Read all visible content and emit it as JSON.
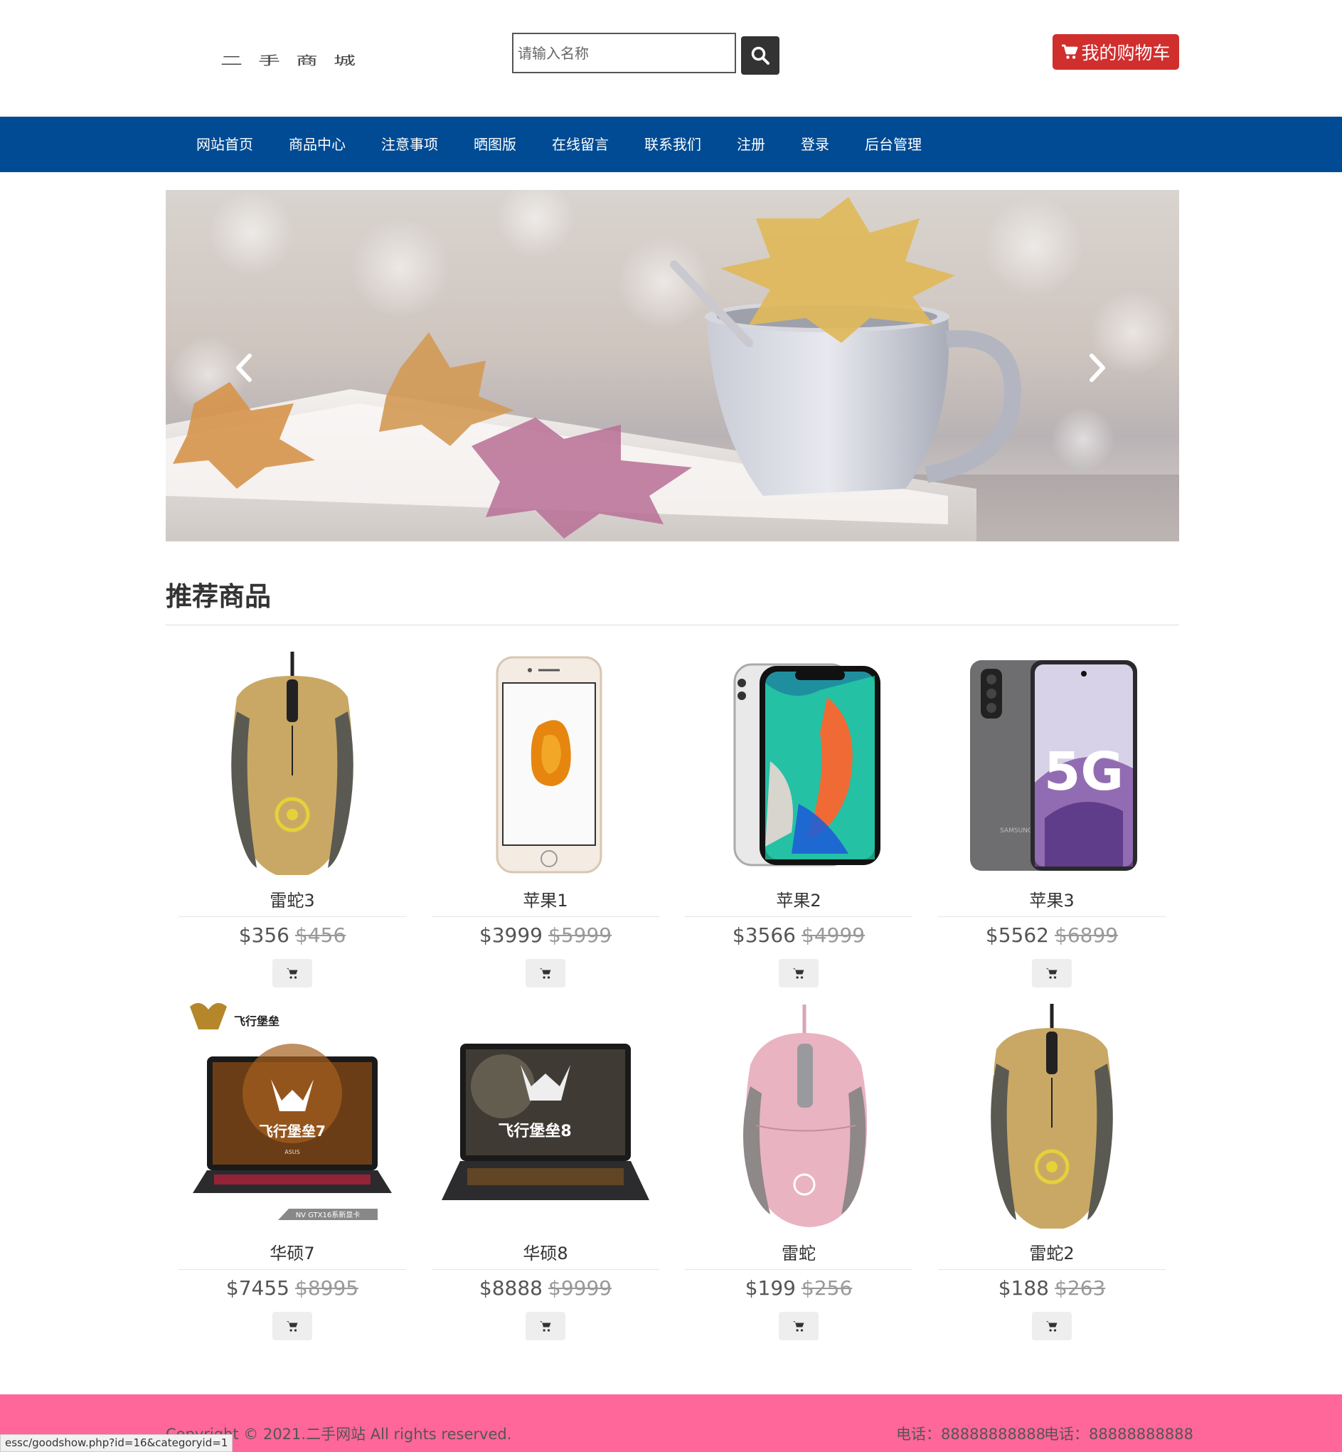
{
  "header": {
    "logo_text": "二手商城",
    "search_placeholder": "请输入名称",
    "cart_label": "我的购物车"
  },
  "nav": {
    "items": [
      {
        "label": "网站首页"
      },
      {
        "label": "商品中心"
      },
      {
        "label": "注意事项"
      },
      {
        "label": "晒图版"
      },
      {
        "label": "在线留言"
      },
      {
        "label": "联系我们"
      },
      {
        "label": "注册"
      },
      {
        "label": "登录"
      },
      {
        "label": "后台管理"
      }
    ]
  },
  "section": {
    "title": "推荐商品"
  },
  "products": [
    {
      "name": "雷蛇3",
      "price": "$356",
      "old_price": "$456",
      "image": "gold-mouse"
    },
    {
      "name": "苹果1",
      "price": "$3999",
      "old_price": "$5999",
      "image": "iphone-gold"
    },
    {
      "name": "苹果2",
      "price": "$3566",
      "old_price": "$4999",
      "image": "iphone-x"
    },
    {
      "name": "苹果3",
      "price": "$5562",
      "old_price": "$6899",
      "image": "samsung-5g"
    },
    {
      "name": "华硕7",
      "price": "$7455",
      "old_price": "$8995",
      "image": "laptop-tuf7"
    },
    {
      "name": "华硕8",
      "price": "$8888",
      "old_price": "$9999",
      "image": "laptop-tuf8"
    },
    {
      "name": "雷蛇",
      "price": "$199",
      "old_price": "$256",
      "image": "pink-mouse"
    },
    {
      "name": "雷蛇2",
      "price": "$188",
      "old_price": "$263",
      "image": "gold-mouse"
    }
  ],
  "product_image_text": {
    "samsung_badge": "5G",
    "samsung_brand": "SAMSUNG",
    "tuf7_brand": "飞行堡垒",
    "tuf7_title": "飞行堡垒7",
    "tuf7_gpu": "NV GTX16系新显卡",
    "tuf7_logo": "ASUS",
    "tuf8_title": "飞行堡垒8"
  },
  "footer": {
    "copyright": "Copyright © 2021.二手网站 All rights reserved.",
    "phone1": "电话：88888888888",
    "phone2": "电话：88888888888"
  },
  "status_bar": {
    "url": "essc/goodshow.php?id=16&categoryid=1"
  },
  "colors": {
    "nav_bg": "#004b93",
    "cart_btn": "#d12e2e",
    "footer_bg": "#ff6699",
    "search_btn": "#333333"
  },
  "icons": {
    "search": "search-icon",
    "cart": "cart-icon",
    "prev": "chevron-left-icon",
    "next": "chevron-right-icon"
  }
}
